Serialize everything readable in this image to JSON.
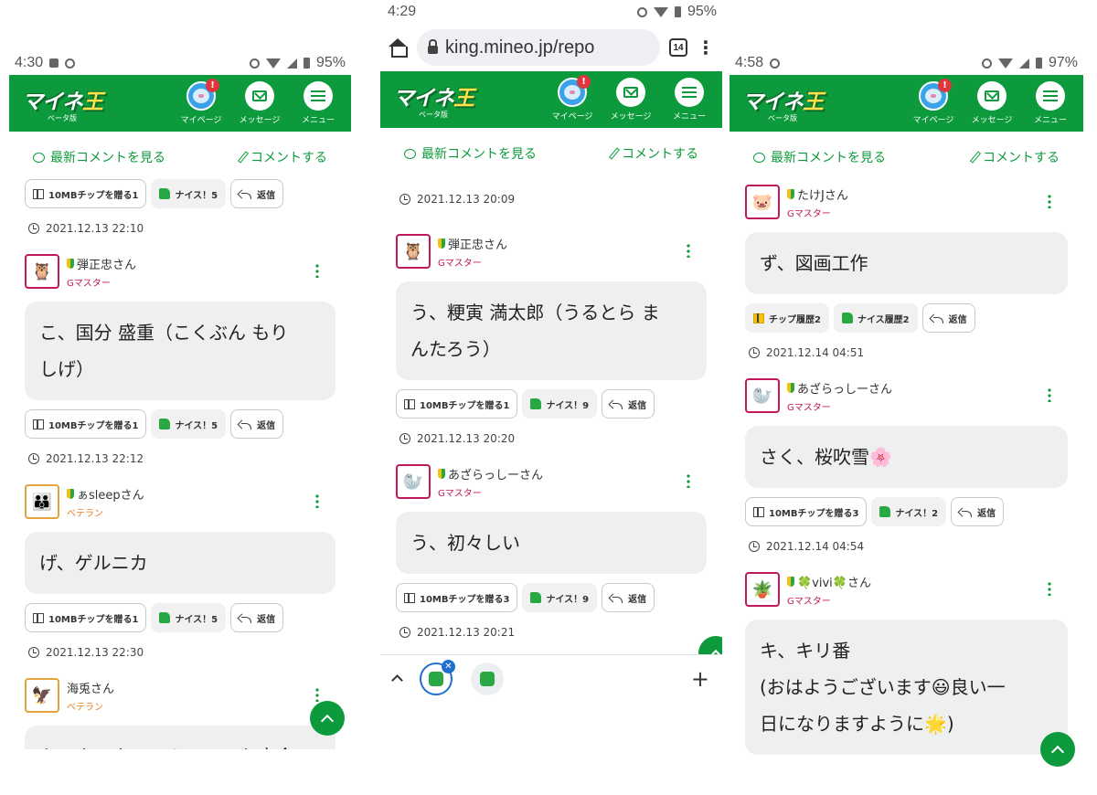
{
  "brand": {
    "logo": "マイネ王",
    "sub": "ベータ版"
  },
  "nav": {
    "mypage": "マイページ",
    "messages": "メッセージ",
    "menu": "メニュー",
    "badge": "!"
  },
  "actions": {
    "latest": "最新コメントを見る",
    "comment": "コメントする"
  },
  "colors": {
    "brand_green": "#0c9a3c",
    "rank_gmaster": "#c2185b",
    "rank_veteran": "#e67e22",
    "badge_red": "#e2343c"
  },
  "screen1": {
    "status": {
      "time": "4:30",
      "battery": "95%"
    },
    "top_buttons": {
      "chip": "10MBチップを贈る1",
      "nice": "ナイス！5",
      "reply": "返信"
    },
    "top_stamp": "2021.12.13 22:10",
    "posts": [
      {
        "avatar_icon": "owl-icon",
        "user": "弾正忠さん",
        "rank": "Gマスター",
        "text1": "こ、国分 盛重（こくぶん もり",
        "text2": "しげ）",
        "chip": "10MBチップを贈る1",
        "nice": "ナイス！5",
        "reply": "返信",
        "stamp": "2021.12.13 22:12"
      },
      {
        "avatar_icon": "family-photo-icon",
        "user": "ぁsleepさん",
        "rank": "ベテラン",
        "text1": "げ、ゲルニカ",
        "chip": "10MBチップを贈る1",
        "nice": "ナイス！5",
        "reply": "返信",
        "stamp": "2021.12.13 22:30"
      },
      {
        "avatar_icon": "eagle-icon",
        "user": "海兎さん",
        "rank": "ベテラン",
        "text1": "か、カニクリームコロッケ定食"
      }
    ]
  },
  "screen2": {
    "status": {
      "time": "4:29",
      "battery": "95%"
    },
    "browser": {
      "url": "king.mineo.jp/repo",
      "tabs": "14"
    },
    "top_stamp": "2021.12.13 20:09",
    "posts": [
      {
        "avatar_icon": "owl-icon",
        "user": "弾正忠さん",
        "rank": "Gマスター",
        "text1": "う、粳寅 満太郎（うるとら ま",
        "text2": "んたろう）",
        "chip": "10MBチップを贈る1",
        "nice": "ナイス！9",
        "reply": "返信",
        "stamp": "2021.12.13 20:20"
      },
      {
        "avatar_icon": "santa-seal-icon",
        "user": "あざらっしーさん",
        "rank": "Gマスター",
        "text1": "う、初々しい",
        "chip": "10MBチップを贈る3",
        "nice": "ナイス！9",
        "reply": "返信",
        "stamp": "2021.12.13 20:21"
      }
    ]
  },
  "screen3": {
    "status": {
      "time": "4:58",
      "battery": "97%"
    },
    "posts": [
      {
        "avatar_icon": "pig-icon",
        "user": "たけJさん",
        "rank": "Gマスター",
        "text1": "ず、図画工作",
        "chip": "チップ履歴2",
        "nice": "ナイス履歴2",
        "reply": "返信",
        "stamp": "2021.12.14 04:51"
      },
      {
        "avatar_icon": "santa-seal-icon",
        "user": "あざらっしーさん",
        "rank": "Gマスター",
        "text1": "さく、桜吹雪🌸",
        "chip": "10MBチップを贈る3",
        "nice": "ナイス！2",
        "reply": "返信",
        "stamp": "2021.12.14 04:54"
      },
      {
        "avatar_icon": "plant-icon",
        "user": "🍀vivi🍀さん",
        "rank": "Gマスター",
        "text1": "キ、キリ番",
        "text2": "(おはようございます😃良い一",
        "text3": "日になりますように🌟)"
      }
    ]
  }
}
